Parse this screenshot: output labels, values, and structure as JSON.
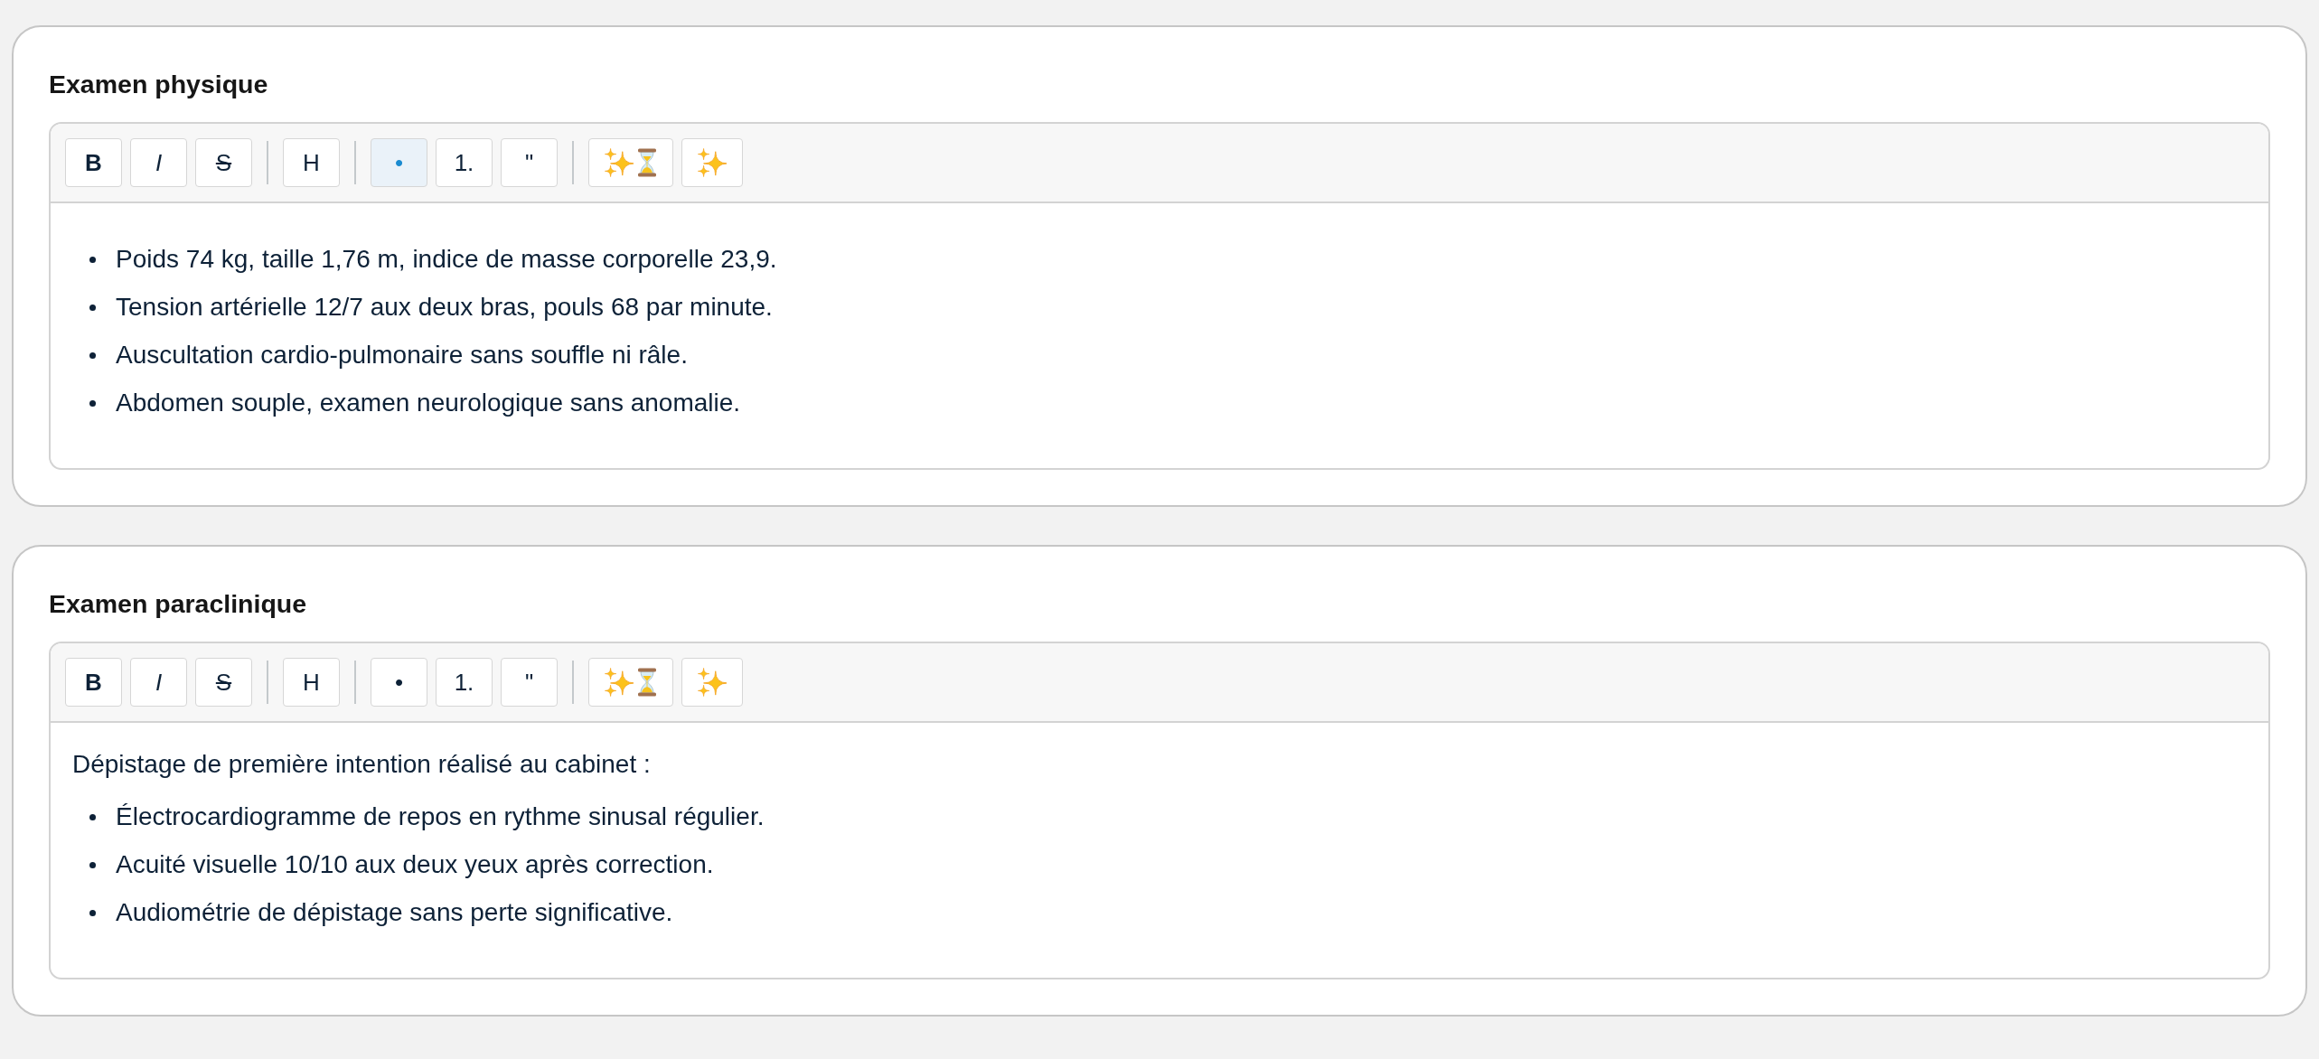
{
  "sections": [
    {
      "title": "Examen physique",
      "toolbar": [
        {
          "buttons": [
            {
              "kind": "bold",
              "label": "B",
              "selected": false
            },
            {
              "kind": "italic",
              "label": "I",
              "selected": false
            },
            {
              "kind": "strike",
              "label": "S",
              "selected": false
            }
          ]
        },
        {
          "buttons": [
            {
              "kind": "heading",
              "label": "H",
              "selected": false
            }
          ]
        },
        {
          "buttons": [
            {
              "kind": "bullet",
              "label": "•",
              "selected": true
            },
            {
              "kind": "ordered",
              "label": "1.",
              "selected": false
            },
            {
              "kind": "quote",
              "label": "\"",
              "selected": false
            }
          ]
        },
        {
          "buttons": [
            {
              "kind": "sparkle-hourglass",
              "selected": false
            },
            {
              "kind": "sparkle",
              "selected": false
            }
          ]
        }
      ],
      "body": [
        {
          "kind": "list",
          "items": [
            "Poids 74 kg, taille 1,76 m, indice de masse corporelle 23,9.",
            "Tension artérielle 12/7 aux deux bras, pouls 68 par minute.",
            "Auscultation cardio-pulmonaire sans souffle ni râle.",
            "Abdomen souple, examen neurologique sans anomalie."
          ]
        }
      ]
    },
    {
      "title": "Examen paraclinique",
      "toolbar": [
        {
          "buttons": [
            {
              "kind": "bold",
              "label": "B",
              "selected": false
            },
            {
              "kind": "italic",
              "label": "I",
              "selected": false
            },
            {
              "kind": "strike",
              "label": "S",
              "selected": false
            }
          ]
        },
        {
          "buttons": [
            {
              "kind": "heading",
              "label": "H",
              "selected": false
            }
          ]
        },
        {
          "buttons": [
            {
              "kind": "bullet",
              "label": "•",
              "selected": false
            },
            {
              "kind": "ordered",
              "label": "1.",
              "selected": false
            },
            {
              "kind": "quote",
              "label": "\"",
              "selected": false
            }
          ]
        },
        {
          "buttons": [
            {
              "kind": "sparkle-hourglass",
              "selected": false
            },
            {
              "kind": "sparkle",
              "selected": false
            }
          ]
        }
      ],
      "body": [
        {
          "kind": "paragraph",
          "text": "Dépistage de première intention réalisé au cabinet :"
        },
        {
          "kind": "list",
          "items": [
            "Électrocardiogramme de repos en rythme sinusal régulier.",
            "Acuité visuelle 10/10 aux deux yeux après correction.",
            "Audiométrie de dépistage sans perte significative."
          ]
        }
      ]
    }
  ]
}
